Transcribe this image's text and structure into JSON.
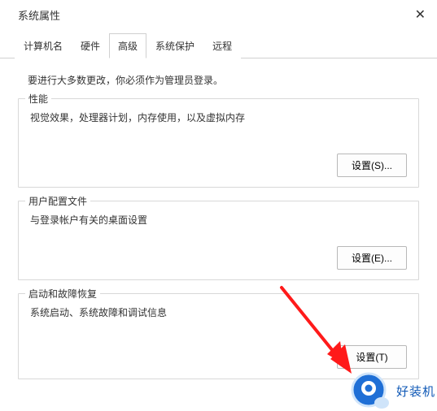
{
  "titlebar": {
    "title": "系统属性"
  },
  "tabs": {
    "t0": "计算机名",
    "t1": "硬件",
    "t2": "高级",
    "t3": "系统保护",
    "t4": "远程"
  },
  "content": {
    "admin_note": "要进行大多数更改，你必须作为管理员登录。",
    "group_perf": {
      "title": "性能",
      "desc": "视觉效果，处理器计划，内存使用，以及虚拟内存",
      "btn": "设置(S)..."
    },
    "group_profile": {
      "title": "用户配置文件",
      "desc": "与登录帐户有关的桌面设置",
      "btn": "设置(E)..."
    },
    "group_startup": {
      "title": "启动和故障恢复",
      "desc": "系统启动、系统故障和调试信息",
      "btn": "设置(T)"
    }
  },
  "watermark": {
    "text": "好装机"
  }
}
